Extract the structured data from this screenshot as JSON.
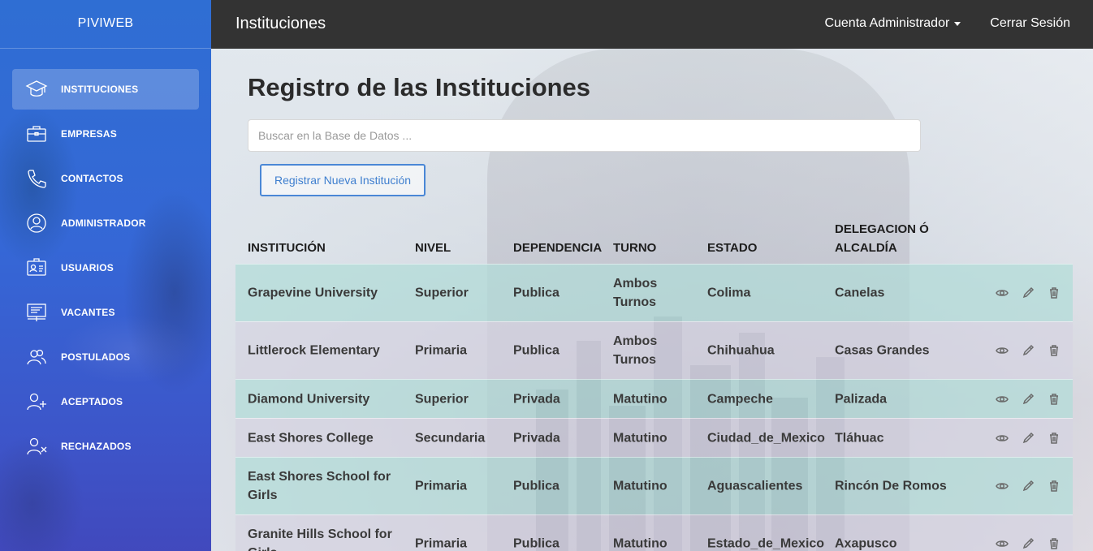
{
  "app": {
    "brand": "PIVIWEB"
  },
  "sidebar": {
    "items": [
      {
        "label": "INSTITUCIONES",
        "icon": "graduation-cap-icon",
        "active": true
      },
      {
        "label": "EMPRESAS",
        "icon": "briefcase-icon",
        "active": false
      },
      {
        "label": "CONTACTOS",
        "icon": "phone-icon",
        "active": false
      },
      {
        "label": "ADMINISTRADOR",
        "icon": "user-circle-icon",
        "active": false
      },
      {
        "label": "USUARIOS",
        "icon": "id-card-icon",
        "active": false
      },
      {
        "label": "VACANTES",
        "icon": "presentation-board-icon",
        "active": false
      },
      {
        "label": "POSTULADOS",
        "icon": "users-icon",
        "active": false
      },
      {
        "label": "ACEPTADOS",
        "icon": "user-plus-icon",
        "active": false
      },
      {
        "label": "RECHAZADOS",
        "icon": "user-x-icon",
        "active": false
      }
    ]
  },
  "topbar": {
    "title": "Instituciones",
    "account_label": "Cuenta Administrador",
    "logout_label": "Cerrar Sesión"
  },
  "main": {
    "title": "Registro de las Instituciones",
    "search_placeholder": "Buscar en la Base de Datos ...",
    "register_button": "Registrar Nueva Institución"
  },
  "table": {
    "headers": [
      "INSTITUCIÓN",
      "NIVEL",
      "DEPENDENCIA",
      "TURNO",
      "ESTADO",
      "DELEGACION Ó ALCALDÍA"
    ],
    "rows": [
      [
        "Grapevine University",
        "Superior",
        "Publica",
        "Ambos Turnos",
        "Colima",
        "Canelas"
      ],
      [
        "Littlerock Elementary",
        "Primaria",
        "Publica",
        "Ambos Turnos",
        "Chihuahua",
        "Casas Grandes"
      ],
      [
        "Diamond University",
        "Superior",
        "Privada",
        "Matutino",
        "Campeche",
        "Palizada"
      ],
      [
        "East Shores College",
        "Secundaria",
        "Privada",
        "Matutino",
        "Ciudad_de_Mexico",
        "Tláhuac"
      ],
      [
        "East Shores School for Girls",
        "Primaria",
        "Publica",
        "Matutino",
        "Aguascalientes",
        "Rincón De Romos"
      ],
      [
        "Granite Hills School for Girls",
        "Primaria",
        "Publica",
        "Matutino",
        "Estado_de_Mexico",
        "Axapusco"
      ]
    ],
    "row_actions": [
      "eye-icon",
      "pencil-icon",
      "trash-icon"
    ]
  },
  "colors": {
    "sidebar_top": "#2f6ed3",
    "sidebar_bottom": "#4149bd",
    "topbar": "#333333",
    "accent": "#4a87d6",
    "row_teal": "#b2dcd8",
    "row_lavender": "#d6d4e2"
  }
}
